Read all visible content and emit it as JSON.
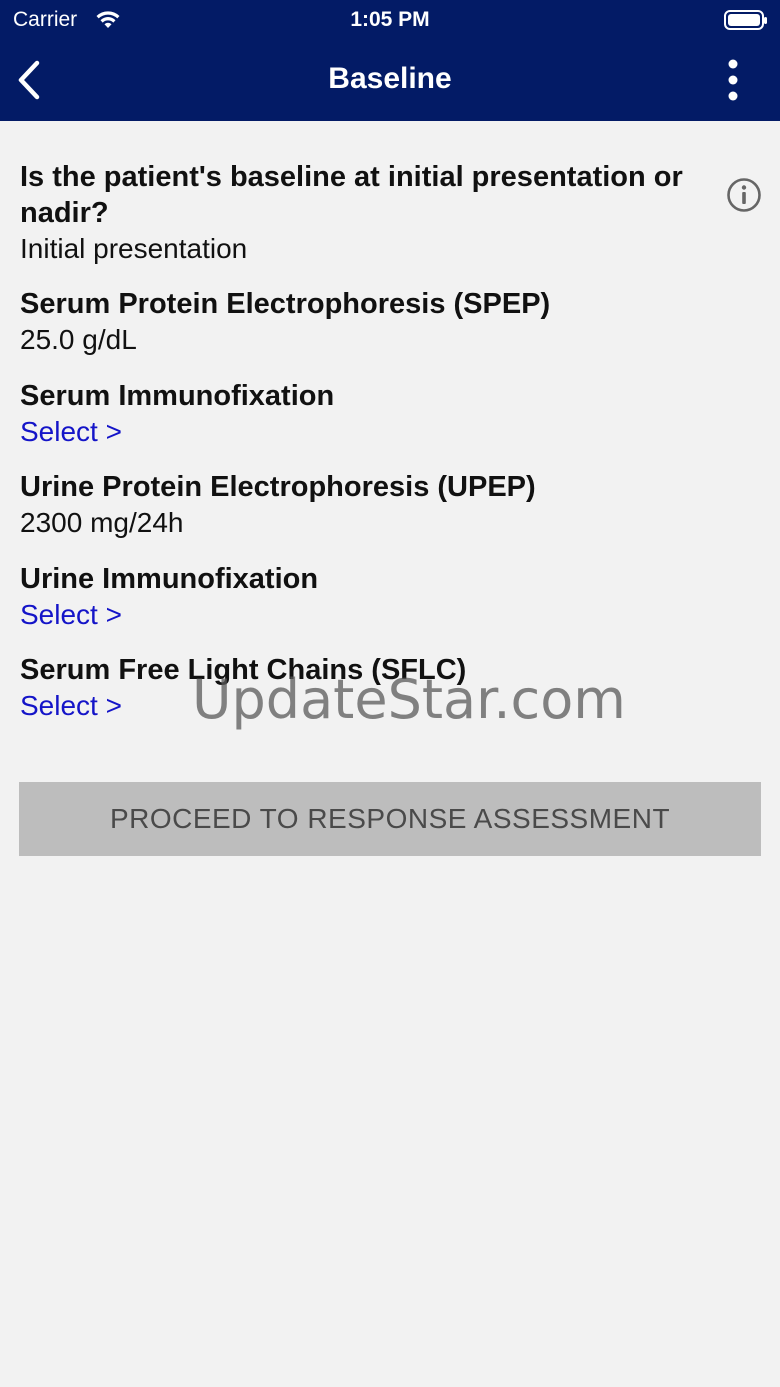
{
  "status_bar": {
    "carrier": "Carrier",
    "time": "1:05 PM",
    "wifi_icon": "wifi-icon",
    "battery_icon": "battery-icon"
  },
  "nav": {
    "title": "Baseline",
    "back_icon": "chevron-left-icon",
    "more_icon": "more-vertical-icon"
  },
  "fields": [
    {
      "label": "Is the patient's baseline at initial presentation or nadir?",
      "value": "Initial presentation",
      "kind": "value"
    },
    {
      "label": "Serum Protein Electrophoresis (SPEP)",
      "value": "25.0 g/dL",
      "kind": "value"
    },
    {
      "label": "Serum Immunofixation",
      "value": "Select >",
      "kind": "select"
    },
    {
      "label": "Urine Protein Electrophoresis (UPEP)",
      "value": "2300 mg/24h",
      "kind": "value"
    },
    {
      "label": "Urine Immunofixation",
      "value": "Select >",
      "kind": "select"
    },
    {
      "label": "Serum Free Light Chains (SFLC)",
      "value": "Select >",
      "kind": "select"
    }
  ],
  "info_icon": "info-circle-icon",
  "proceed_button": {
    "label": "PROCEED TO RESPONSE ASSESSMENT"
  },
  "watermark": "UpdateStar.com",
  "colors": {
    "header_bg": "#031b66",
    "page_bg": "#f2f2f2",
    "select_link": "#1414c8",
    "button_bg": "#bdbdbd"
  }
}
